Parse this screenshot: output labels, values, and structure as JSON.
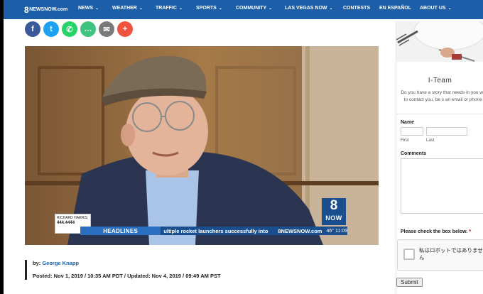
{
  "nav": {
    "logo_big": "8",
    "logo_small": "NEWSNOW.com",
    "items": [
      {
        "label": "NEWS",
        "dropdown": true
      },
      {
        "label": "WEATHER",
        "dropdown": true
      },
      {
        "label": "TRAFFIC",
        "dropdown": true
      },
      {
        "label": "SPORTS",
        "dropdown": true
      },
      {
        "label": "COMMUNITY",
        "dropdown": true
      },
      {
        "label": "LAS VEGAS NOW",
        "dropdown": true
      },
      {
        "label": "CONTESTS",
        "dropdown": false
      },
      {
        "label": "EN ESPAÑOL",
        "dropdown": false
      },
      {
        "label": "ABOUT US",
        "dropdown": true
      }
    ],
    "chevron": "⌄"
  },
  "share": {
    "buttons": [
      {
        "name": "facebook-icon",
        "glyph": "f",
        "color": "#3b5998"
      },
      {
        "name": "twitter-icon",
        "glyph": "t",
        "color": "#1da1f2"
      },
      {
        "name": "whatsapp-icon",
        "glyph": "✆",
        "color": "#25d366"
      },
      {
        "name": "sms-icon",
        "glyph": "…",
        "color": "#3fc380"
      },
      {
        "name": "email-icon",
        "glyph": "✉",
        "color": "#7a7a7a"
      },
      {
        "name": "more-icon",
        "glyph": "+",
        "color": "#f0533f"
      }
    ]
  },
  "video": {
    "headlines_label": "HEADLINES",
    "ticker_text": "ultiple rocket launchers successfully into",
    "ticker_logo": "8NEWSNOW.com",
    "ticker_temp": "46° 11:09",
    "sponsor_name": "RICHARD HARRIS",
    "sponsor_phone": "444.4444",
    "station_number": "8",
    "station_word": "NOW"
  },
  "byline": {
    "by_label": "by:",
    "author": "George Knapp",
    "posted": "Posted: Nov 1, 2019 / 10:35 AM PDT / Updated: Nov 4, 2019 / 09:49 AM PST"
  },
  "sidebar": {
    "title": "I-Team",
    "description": "Do you have a story that needs in you want us to contact you, be s an email or phone num",
    "name_label": "Name",
    "first_label": "First",
    "last_label": "Last",
    "comments_label": "Comments",
    "captcha_prompt": "Please check the box below.",
    "required_mark": "*",
    "captcha_text": "私はロボットではありません",
    "submit_label": "Submit"
  }
}
